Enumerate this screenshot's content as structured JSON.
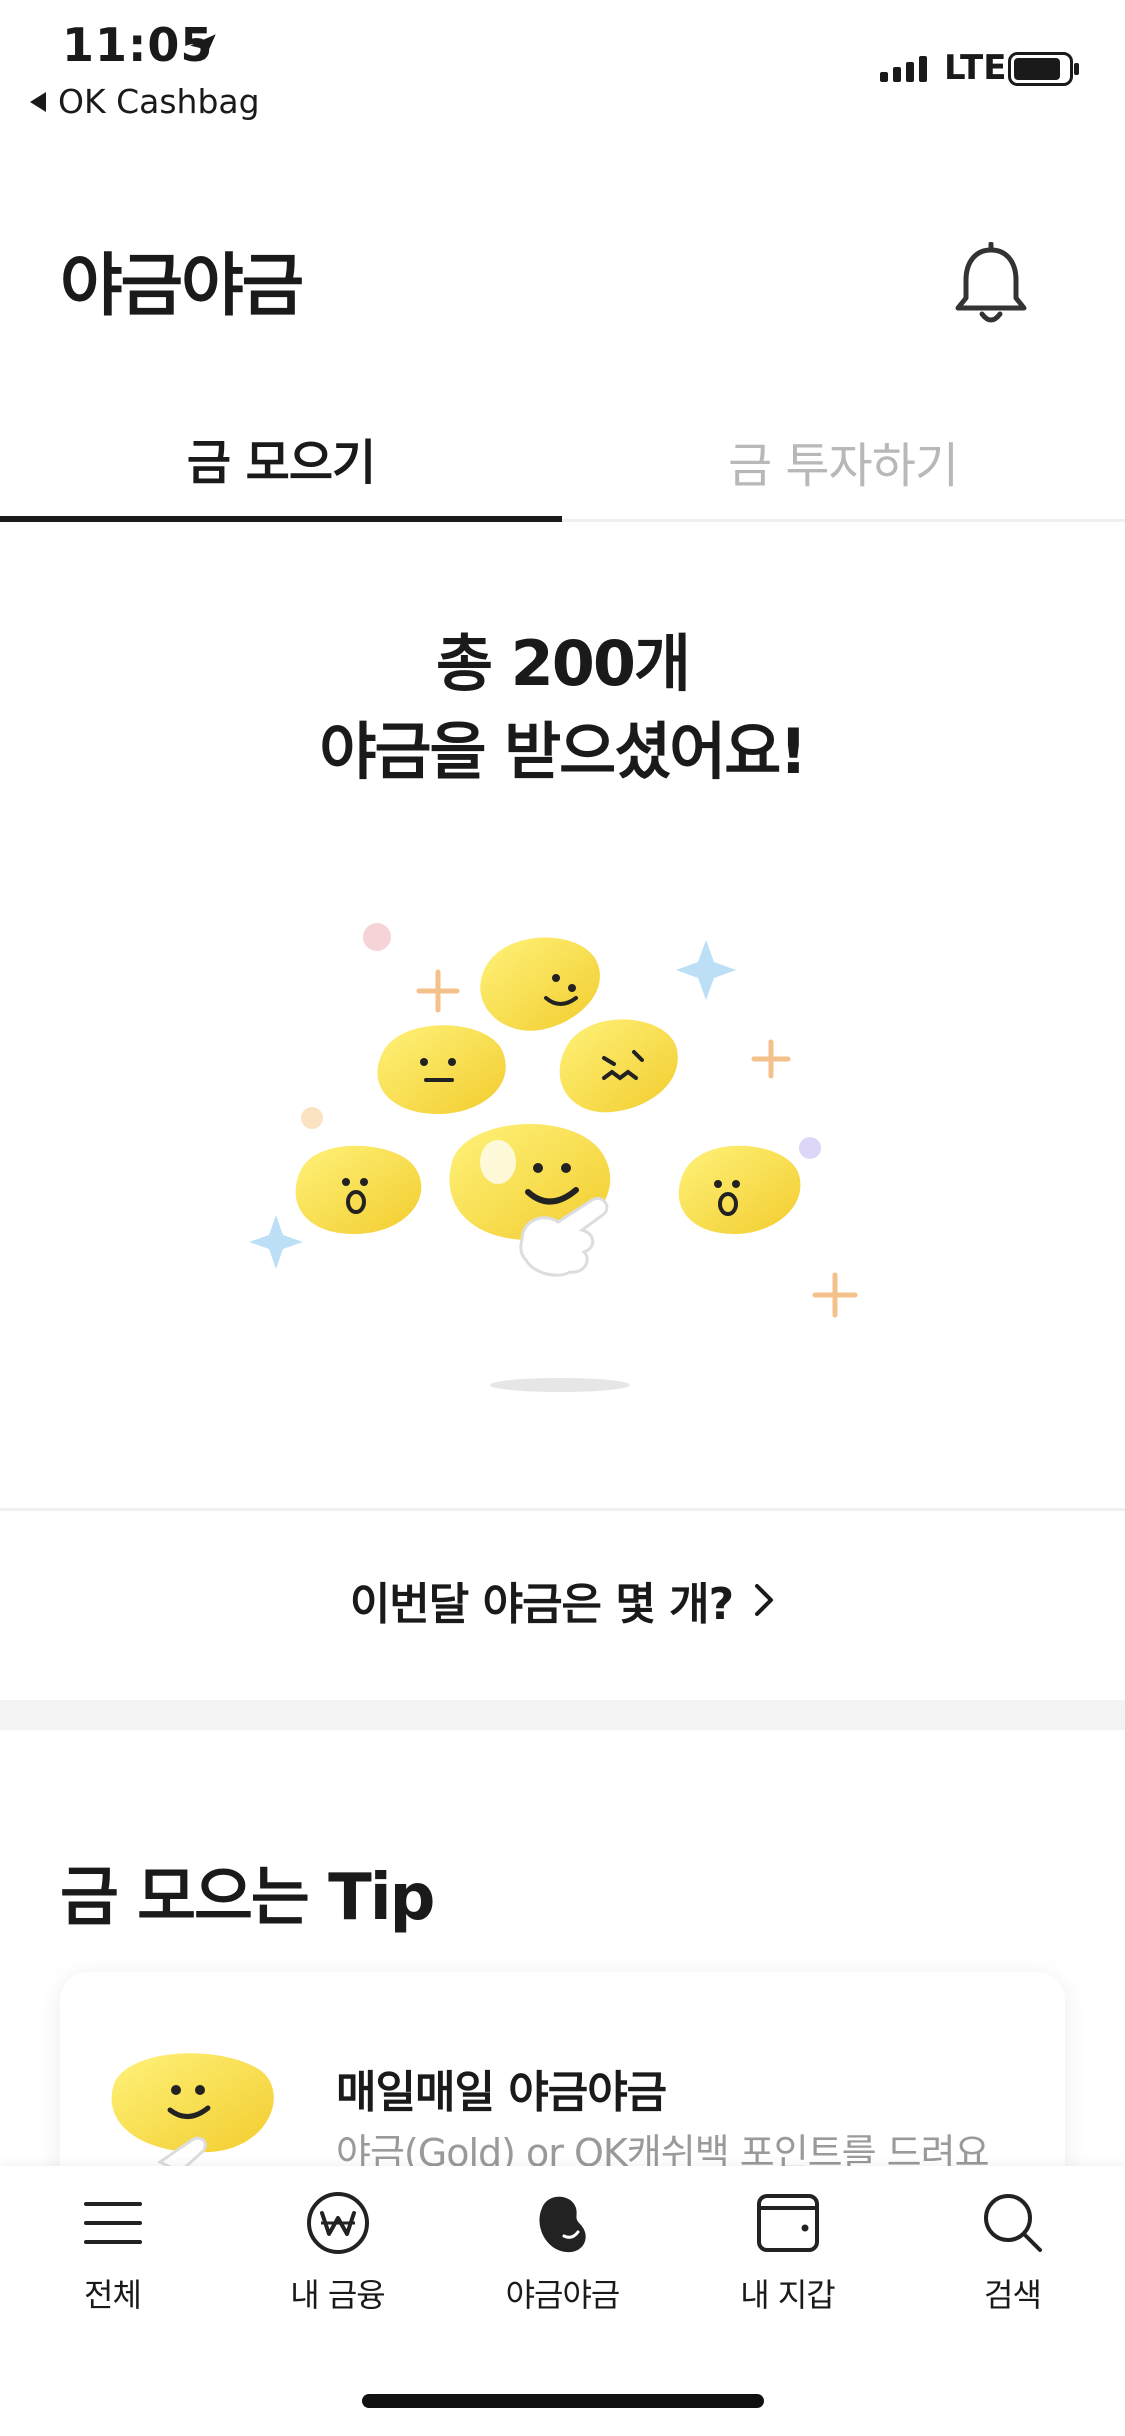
{
  "status_bar": {
    "time": "11:05",
    "back_app": "OK Cashbag",
    "network": "LTE",
    "icons": [
      "location-arrow-icon",
      "signal-icon",
      "battery-icon"
    ]
  },
  "header": {
    "title": "야금야금",
    "notification_icon": "bell-icon"
  },
  "tabs": [
    {
      "label": "금 모으기",
      "active": true
    },
    {
      "label": "금 투자하기",
      "active": false
    }
  ],
  "hero": {
    "line1": "총 200개",
    "line2": "야금을 받으셨어요!"
  },
  "monthly_link": {
    "label": "이번달 야금은 몇 개?"
  },
  "tips": {
    "title": "금 모으는 Tip",
    "card": {
      "title": "매일매일 야금야금",
      "description": "야금(Gold) or OK캐쉬백 포인트를 드려요"
    }
  },
  "bottom_nav": [
    {
      "label": "전체",
      "icon": "menu-icon"
    },
    {
      "label": "내 금융",
      "icon": "won-coin-icon"
    },
    {
      "label": "야금야금",
      "icon": "bean-icon"
    },
    {
      "label": "내 지갑",
      "icon": "wallet-icon"
    },
    {
      "label": "검색",
      "icon": "search-icon"
    }
  ],
  "colors": {
    "bean_yellow": "#f6d93b",
    "bean_highlight": "#fff48a",
    "text_primary": "#1a1a1a",
    "text_inactive": "#b8b8b8",
    "text_secondary": "#9a9a9a"
  }
}
